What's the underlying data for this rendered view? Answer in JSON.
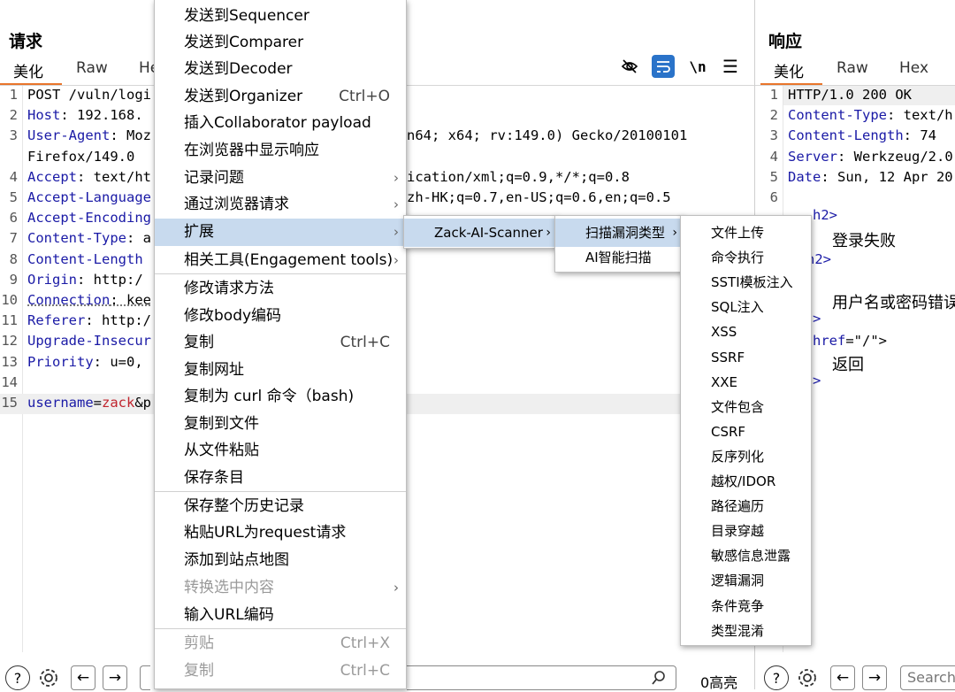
{
  "request": {
    "title": "请求",
    "tabs": [
      "美化",
      "Raw",
      "He"
    ],
    "toolbar": {
      "wrap_toggle": "\\n"
    },
    "lines": [
      {
        "n": "1",
        "parts": [
          {
            "t": "POST /vuln/logi",
            "c": "val"
          }
        ]
      },
      {
        "n": "2",
        "parts": [
          {
            "t": "Host",
            "c": "hdr"
          },
          {
            "t": ": 192.168.",
            "c": "val"
          }
        ]
      },
      {
        "n": "3",
        "parts": [
          {
            "t": "User-Agent",
            "c": "hdr"
          },
          {
            "t": ": Moz",
            "c": "val"
          }
        ]
      },
      {
        "n": "",
        "parts": [
          {
            "t": "Firefox/149.0",
            "c": "val"
          }
        ]
      },
      {
        "n": "4",
        "parts": [
          {
            "t": "Accept",
            "c": "hdr"
          },
          {
            "t": ": text/ht",
            "c": "val"
          }
        ]
      },
      {
        "n": "5",
        "parts": [
          {
            "t": "Accept-Language",
            "c": "hdr"
          }
        ]
      },
      {
        "n": "6",
        "parts": [
          {
            "t": "Accept-Encoding",
            "c": "hdr"
          }
        ]
      },
      {
        "n": "7",
        "parts": [
          {
            "t": "Content-Type",
            "c": "hdr"
          },
          {
            "t": ": a",
            "c": "val"
          }
        ]
      },
      {
        "n": "8",
        "parts": [
          {
            "t": "Content-Length",
            "c": "hdr"
          }
        ]
      },
      {
        "n": "9",
        "parts": [
          {
            "t": "Origin",
            "c": "hdr"
          },
          {
            "t": ": http:/",
            "c": "val"
          }
        ]
      },
      {
        "n": "10",
        "parts": [
          {
            "t": "Connection",
            "c": "hdr uline"
          },
          {
            "t": ": kee",
            "c": "val uline"
          }
        ]
      },
      {
        "n": "11",
        "parts": [
          {
            "t": "Referer",
            "c": "hdr"
          },
          {
            "t": ": http:/",
            "c": "val"
          }
        ]
      },
      {
        "n": "12",
        "parts": [
          {
            "t": "Upgrade-Insecur",
            "c": "hdr"
          }
        ]
      },
      {
        "n": "13",
        "parts": [
          {
            "t": "Priority",
            "c": "hdr"
          },
          {
            "t": ": u=0,",
            "c": "val"
          }
        ]
      },
      {
        "n": "14",
        "parts": []
      },
      {
        "n": "15",
        "parts": [
          {
            "t": "username",
            "c": "param-name"
          },
          {
            "t": "=",
            "c": "val"
          },
          {
            "t": "zack",
            "c": "param-val"
          },
          {
            "t": "&p",
            "c": "val"
          }
        ]
      }
    ],
    "overflow_right": [
      {
        "row": 2,
        "text": "n64; x64; rv:149.0) Gecko/20100101"
      },
      {
        "row": 4,
        "text": "ication/xml;q=0.9,*/*;q=0.8"
      },
      {
        "row": 5,
        "text": "zh-HK;q=0.7,en-US;q=0.6,en;q=0.5"
      }
    ],
    "search_highlight": "0高亮"
  },
  "response": {
    "title": "响应",
    "tabs": [
      "美化",
      "Raw",
      "Hex"
    ],
    "lines": [
      {
        "n": "1",
        "parts": [
          {
            "t": "HTTP/1.0 200 OK",
            "c": "val"
          }
        ]
      },
      {
        "n": "2",
        "parts": [
          {
            "t": "Content-Type",
            "c": "hdr"
          },
          {
            "t": ": text/h",
            "c": "val"
          }
        ]
      },
      {
        "n": "3",
        "parts": [
          {
            "t": "Content-Length",
            "c": "hdr"
          },
          {
            "t": ": 74",
            "c": "val"
          }
        ]
      },
      {
        "n": "4",
        "parts": [
          {
            "t": "Server",
            "c": "hdr"
          },
          {
            "t": ": Werkzeug/2.0",
            "c": "val"
          }
        ]
      },
      {
        "n": "5",
        "parts": [
          {
            "t": "Date",
            "c": "hdr"
          },
          {
            "t": ": Sun, 12 Apr 20",
            "c": "val"
          }
        ]
      },
      {
        "n": "6",
        "parts": []
      }
    ],
    "body_fragments": {
      "h2_open_1": "h2>",
      "login_failed": "登录失败",
      "h2_close": "h2>",
      "p_fragment": ">",
      "user_pwd_error": "用户名或密码错误",
      "p_close": ">",
      "a_href": "href",
      "a_eq": "=\"/\">",
      "back": "返回",
      "a_close": ">"
    },
    "search_placeholder": "Search"
  },
  "context_menu": {
    "items": [
      {
        "label": "发送到Sequencer"
      },
      {
        "label": "发送到Comparer"
      },
      {
        "label": "发送到Decoder"
      },
      {
        "label": "发送到Organizer",
        "shortcut": "Ctrl+O"
      },
      {
        "label": "插入Collaborator payload"
      },
      {
        "label": "在浏览器中显示响应"
      },
      {
        "label": "记录问题",
        "submenu": true
      },
      {
        "label": "通过浏览器请求",
        "submenu": true
      },
      {
        "label": "扩展",
        "submenu": true,
        "highlight": true
      },
      {
        "label": "相关工具(Engagement tools)",
        "submenu": true
      },
      {
        "label": "修改请求方法"
      },
      {
        "label": "修改body编码"
      },
      {
        "label": "复制",
        "shortcut": "Ctrl+C"
      },
      {
        "label": "复制网址"
      },
      {
        "label": "复制为 curl 命令（bash)"
      },
      {
        "label": "复制到文件"
      },
      {
        "label": "从文件粘贴"
      },
      {
        "label": "保存条目"
      },
      {
        "label": "保存整个历史记录"
      },
      {
        "label": "粘贴URL为request请求"
      },
      {
        "label": "添加到站点地图"
      },
      {
        "label": "转换选中内容",
        "submenu": true,
        "disabled": true
      },
      {
        "label": "输入URL编码"
      },
      {
        "label": "剪贴",
        "shortcut": "Ctrl+X",
        "disabled": true
      },
      {
        "label": "复制",
        "shortcut": "Ctrl+C",
        "disabled": true
      }
    ]
  },
  "extension_menu": {
    "items": [
      {
        "label": "Zack-AI-Scanner",
        "submenu": true
      }
    ]
  },
  "scanner_menu": {
    "items": [
      {
        "label": "扫描漏洞类型",
        "submenu": true
      },
      {
        "label": "AI智能扫描"
      }
    ]
  },
  "vuln_types_menu": {
    "items": [
      "文件上传",
      "命令执行",
      "SSTI模板注入",
      "SQL注入",
      "XSS",
      "SSRF",
      "XXE",
      "文件包含",
      "CSRF",
      "反序列化",
      "越权/IDOR",
      "路径遍历",
      "目录穿越",
      "敏感信息泄露",
      "逻辑漏洞",
      "条件竞争",
      "类型混淆"
    ]
  },
  "colors": {
    "accent_tab": "#e8752b",
    "menu_highlight": "#c8daee",
    "toolbar_active": "#2a73c9",
    "header_key": "#1a1aa6",
    "param_value": "#c0242d"
  }
}
